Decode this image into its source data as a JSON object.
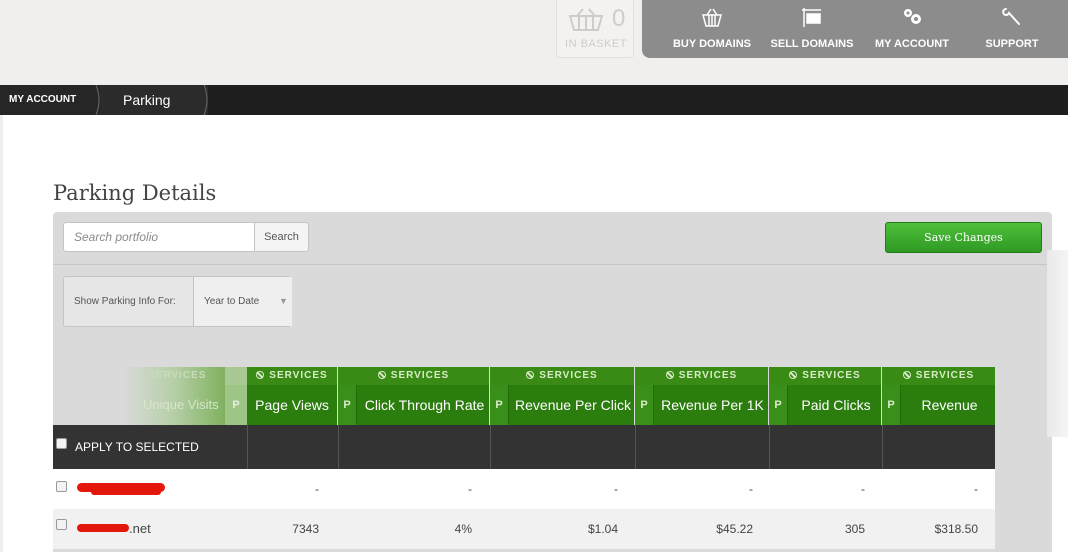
{
  "basket": {
    "count": "0",
    "label": "IN BASKET"
  },
  "nav": [
    {
      "label": "BUY DOMAINS",
      "icon": "basket-icon"
    },
    {
      "label": "SELL DOMAINS",
      "icon": "sign-icon"
    },
    {
      "label": "MY ACCOUNT",
      "icon": "gears-icon"
    },
    {
      "label": "SUPPORT",
      "icon": "wrench-icon"
    }
  ],
  "breadcrumb": {
    "root": "MY ACCOUNT",
    "current": "Parking"
  },
  "page": {
    "title": "Parking Details"
  },
  "toolbar": {
    "search_placeholder": "Search portfolio",
    "search_button": "Search",
    "save_button": "Save Changes"
  },
  "filter": {
    "label": "Show Parking Info For:",
    "value": "Year to Date"
  },
  "table": {
    "service_label": "SERVICES",
    "p_label": "P",
    "faded_column": "Unique Visits",
    "columns": [
      "Page Views",
      "Click Through Rate",
      "Revenue Per Click",
      "Revenue Per 1K",
      "Paid Clicks",
      "Revenue"
    ],
    "apply_label": "APPLY TO SELECTED",
    "rows": [
      {
        "domain_suffix": "",
        "values": [
          "-",
          "-",
          "-",
          "-",
          "-",
          "-"
        ]
      },
      {
        "domain_suffix": ".net",
        "values": [
          "7343",
          "4%",
          "$1.04",
          "$45.22",
          "305",
          "$318.50"
        ]
      }
    ]
  },
  "colors": {
    "accent_green": "#2b7d0e",
    "topnav_gray": "#8c8c8c",
    "save_green": "#3aa82c"
  }
}
